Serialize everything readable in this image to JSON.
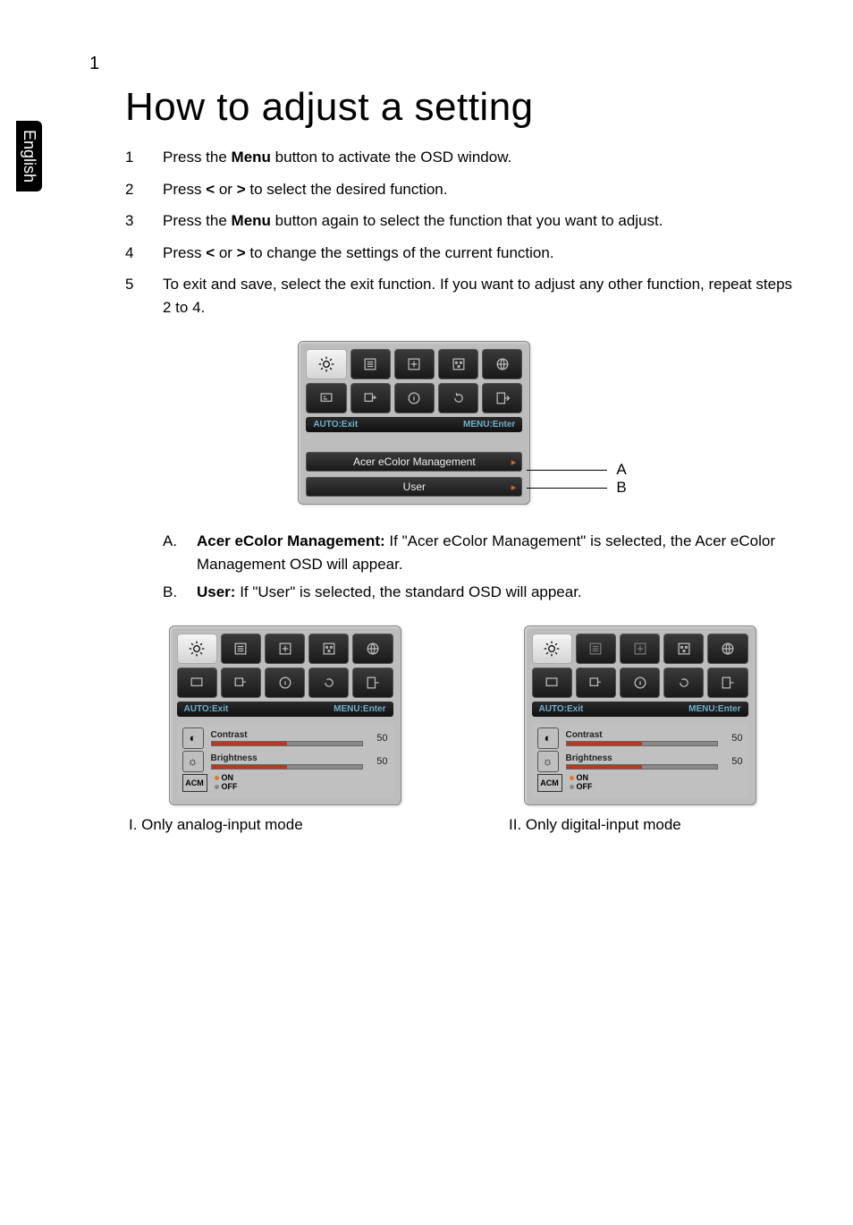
{
  "page_number": "1",
  "side_tab": "English",
  "title": "How to adjust a setting",
  "steps": [
    {
      "pre": "Press the ",
      "bold": "Menu",
      "post": " button to activate the OSD window."
    },
    {
      "pre": "Press ",
      "bold": "<",
      "mid": " or ",
      "bold2": ">",
      "post": " to select the desired function."
    },
    {
      "pre": "Press the ",
      "bold": "Menu",
      "post": " button again to select the function that you want to adjust."
    },
    {
      "pre": "Press ",
      "bold": "<",
      "mid": " or ",
      "bold2": ">",
      "post": " to change the settings of the current function."
    },
    {
      "pre": "",
      "post": "To exit and save, select the exit function. If you want to adjust any other function, repeat steps 2 to 4."
    }
  ],
  "osd": {
    "footer_left": "AUTO:Exit",
    "footer_right": "MENU:Enter",
    "option_a": "Acer eColor Management",
    "option_b": "User",
    "label_a": "A",
    "label_b": "B"
  },
  "explain": {
    "a": {
      "letter": "A.",
      "bold": "Acer eColor Management:",
      "text": " If \"Acer eColor Management\" is selected, the Acer eColor Management OSD will appear."
    },
    "b": {
      "letter": "B.",
      "bold": "User:",
      "text": " If \"User\" is selected, the standard OSD will appear."
    }
  },
  "lower_osd": {
    "contrast_label": "Contrast",
    "contrast_value": "50",
    "brightness_label": "Brightness",
    "brightness_value": "50",
    "acm_label": "ACM",
    "on_label": "ON",
    "off_label": "OFF"
  },
  "captions": {
    "left": "I. Only analog-input mode",
    "right": "II. Only digital-input mode"
  },
  "icons": {
    "brightness": "brightness-icon",
    "menu": "menu-icon",
    "position": "position-icon",
    "color": "color-icon",
    "lang": "globe-icon",
    "osd": "osd-icon",
    "input": "input-icon",
    "info": "info-icon",
    "reset": "reset-icon",
    "exit": "exit-icon"
  }
}
